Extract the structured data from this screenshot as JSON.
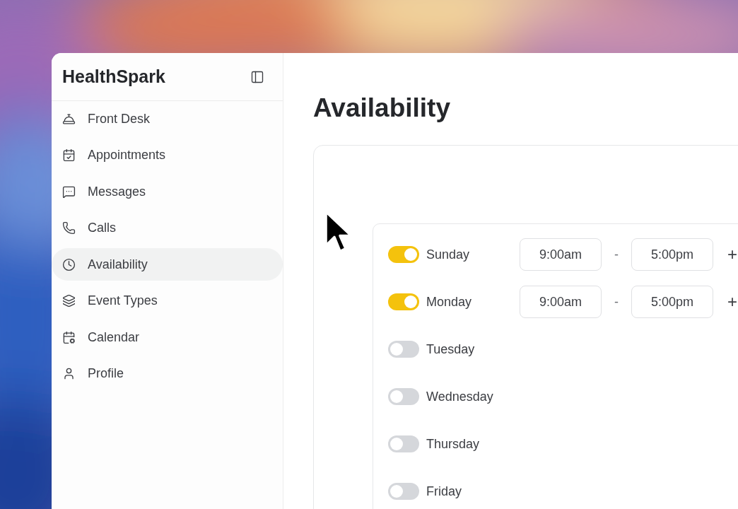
{
  "app": {
    "name": "HealthSpark"
  },
  "sidebar": {
    "items": [
      {
        "label": "Front Desk",
        "selected": false
      },
      {
        "label": "Appointments",
        "selected": false
      },
      {
        "label": "Messages",
        "selected": false
      },
      {
        "label": "Calls",
        "selected": false
      },
      {
        "label": "Availability",
        "selected": true
      },
      {
        "label": "Event Types",
        "selected": false
      },
      {
        "label": "Calendar",
        "selected": false
      },
      {
        "label": "Profile",
        "selected": false
      }
    ]
  },
  "page": {
    "title": "Availability"
  },
  "schedule": {
    "days": [
      {
        "name": "Sunday",
        "on": true,
        "start": "9:00am",
        "separator": "-",
        "end": "5:00pm",
        "add": "+"
      },
      {
        "name": "Monday",
        "on": true,
        "start": "9:00am",
        "separator": "-",
        "end": "5:00pm",
        "add": "+"
      },
      {
        "name": "Tuesday",
        "on": false
      },
      {
        "name": "Wednesday",
        "on": false
      },
      {
        "name": "Thursday",
        "on": false
      },
      {
        "name": "Friday",
        "on": false
      }
    ]
  }
}
